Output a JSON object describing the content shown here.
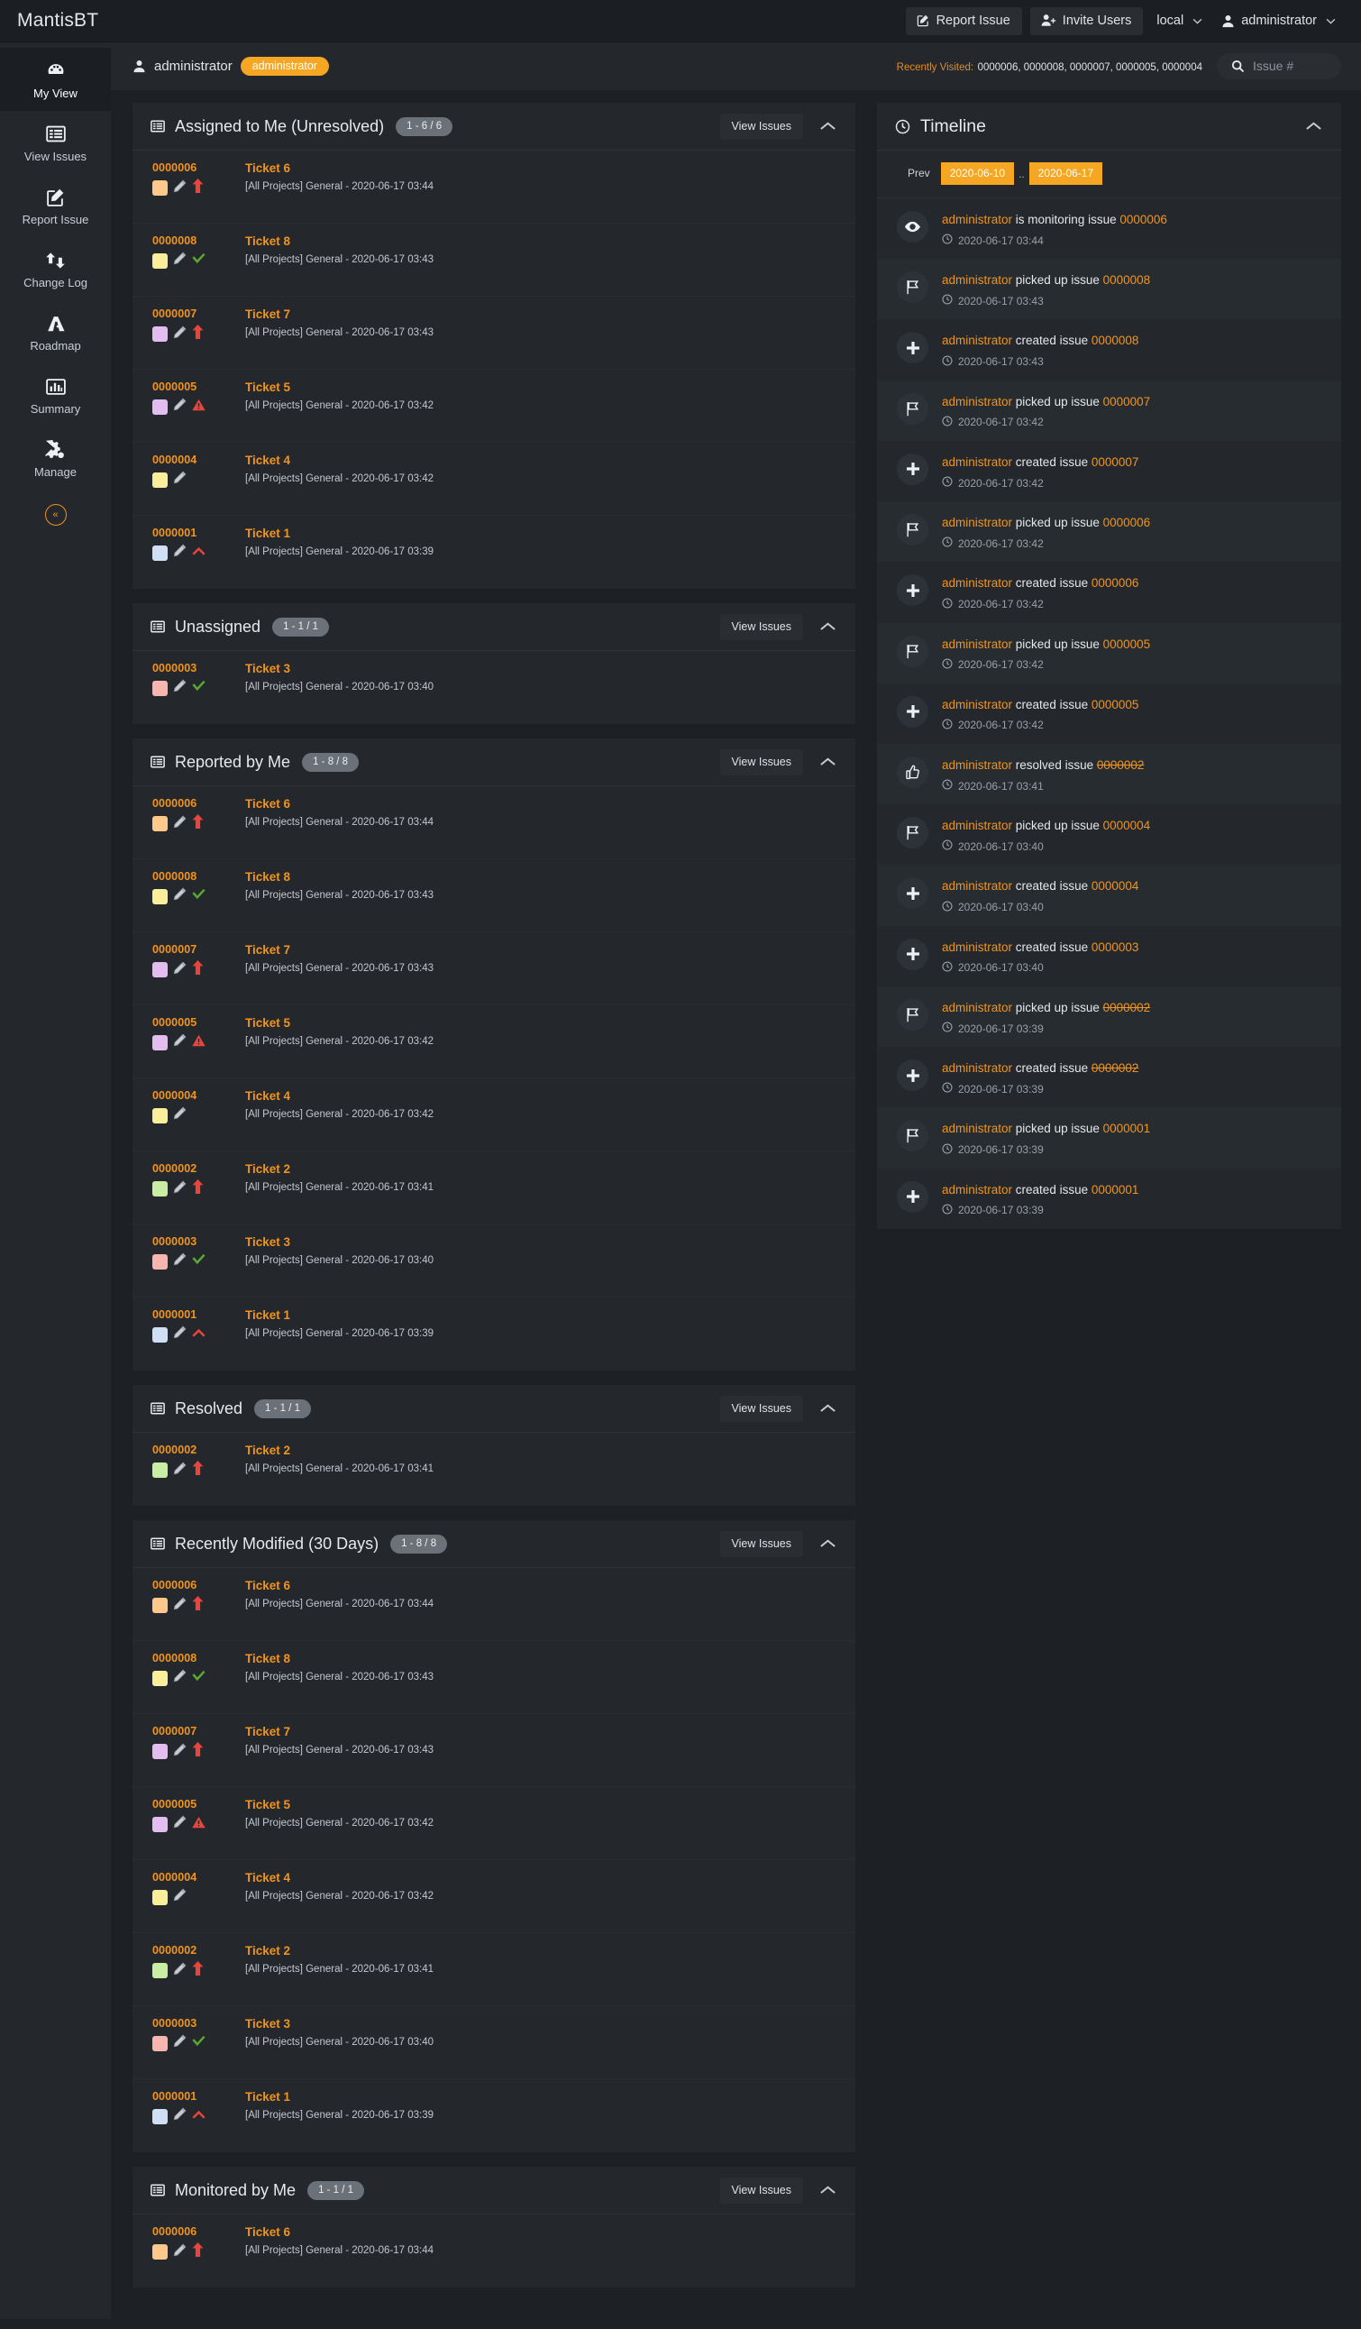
{
  "app": {
    "brand": "MantisBT"
  },
  "topbar": {
    "report_issue": "Report Issue",
    "invite_users": "Invite Users",
    "project": "local",
    "username": "administrator"
  },
  "sidebar": {
    "items": [
      {
        "label": "My View",
        "icon": "dashboard-icon",
        "active": true
      },
      {
        "label": "View Issues",
        "icon": "list-icon",
        "active": false
      },
      {
        "label": "Report Issue",
        "icon": "edit-square-icon",
        "active": false
      },
      {
        "label": "Change Log",
        "icon": "exchange-icon",
        "active": false
      },
      {
        "label": "Roadmap",
        "icon": "road-icon",
        "active": false
      },
      {
        "label": "Summary",
        "icon": "bar-chart-icon",
        "active": false
      },
      {
        "label": "Manage",
        "icon": "gears-icon",
        "active": false
      }
    ],
    "collapse_label": "«"
  },
  "userstrip": {
    "username": "administrator",
    "access_badge": "administrator",
    "recently_visited_label": "Recently Visited:",
    "recently_visited_ids": "0000006, 0000008, 0000007, 0000005, 0000004",
    "search_placeholder": "Issue #",
    "search_value": ""
  },
  "common": {
    "view_issues": "View Issues"
  },
  "panels": [
    {
      "id": "assigned-to-me",
      "title": "Assigned to Me (Unresolved)",
      "count": "1 - 6 / 6",
      "rows": [
        {
          "id": "0000006",
          "title": "Ticket 6",
          "meta": "[All Projects] General - 2020-06-17 03:44",
          "color": "#fdc88a",
          "priority": "arrow-up",
          "priority_color": "#e8453c"
        },
        {
          "id": "0000008",
          "title": "Ticket 8",
          "meta": "[All Projects] General - 2020-06-17 03:43",
          "color": "#f9ee9a",
          "priority": "check",
          "priority_color": "#5aa832"
        },
        {
          "id": "0000007",
          "title": "Ticket 7",
          "meta": "[All Projects] General - 2020-06-17 03:43",
          "color": "#e3bdf0",
          "priority": "arrow-up",
          "priority_color": "#e8453c"
        },
        {
          "id": "0000005",
          "title": "Ticket 5",
          "meta": "[All Projects] General - 2020-06-17 03:42",
          "color": "#e3bdf0",
          "priority": "warning",
          "priority_color": "#e8453c"
        },
        {
          "id": "0000004",
          "title": "Ticket 4",
          "meta": "[All Projects] General - 2020-06-17 03:42",
          "color": "#f9ee9a",
          "priority": "none",
          "priority_color": ""
        },
        {
          "id": "0000001",
          "title": "Ticket 1",
          "meta": "[All Projects] General - 2020-06-17 03:39",
          "color": "#cfe0f5",
          "priority": "chevron-up",
          "priority_color": "#e8453c"
        }
      ]
    },
    {
      "id": "unassigned",
      "title": "Unassigned",
      "count": "1 - 1 / 1",
      "rows": [
        {
          "id": "0000003",
          "title": "Ticket 3",
          "meta": "[All Projects] General - 2020-06-17 03:40",
          "color": "#f7b5b0",
          "priority": "check",
          "priority_color": "#5aa832"
        }
      ]
    },
    {
      "id": "reported-by-me",
      "title": "Reported by Me",
      "count": "1 - 8 / 8",
      "rows": [
        {
          "id": "0000006",
          "title": "Ticket 6",
          "meta": "[All Projects] General - 2020-06-17 03:44",
          "color": "#fdc88a",
          "priority": "arrow-up",
          "priority_color": "#e8453c"
        },
        {
          "id": "0000008",
          "title": "Ticket 8",
          "meta": "[All Projects] General - 2020-06-17 03:43",
          "color": "#f9ee9a",
          "priority": "check",
          "priority_color": "#5aa832"
        },
        {
          "id": "0000007",
          "title": "Ticket 7",
          "meta": "[All Projects] General - 2020-06-17 03:43",
          "color": "#e3bdf0",
          "priority": "arrow-up",
          "priority_color": "#e8453c"
        },
        {
          "id": "0000005",
          "title": "Ticket 5",
          "meta": "[All Projects] General - 2020-06-17 03:42",
          "color": "#e3bdf0",
          "priority": "warning",
          "priority_color": "#e8453c"
        },
        {
          "id": "0000004",
          "title": "Ticket 4",
          "meta": "[All Projects] General - 2020-06-17 03:42",
          "color": "#f9ee9a",
          "priority": "none",
          "priority_color": ""
        },
        {
          "id": "0000002",
          "title": "Ticket 2",
          "meta": "[All Projects] General - 2020-06-17 03:41",
          "color": "#c8eda3",
          "priority": "arrow-up",
          "priority_color": "#e8453c"
        },
        {
          "id": "0000003",
          "title": "Ticket 3",
          "meta": "[All Projects] General - 2020-06-17 03:40",
          "color": "#f7b5b0",
          "priority": "check",
          "priority_color": "#5aa832"
        },
        {
          "id": "0000001",
          "title": "Ticket 1",
          "meta": "[All Projects] General - 2020-06-17 03:39",
          "color": "#cfe0f5",
          "priority": "chevron-up",
          "priority_color": "#e8453c"
        }
      ]
    },
    {
      "id": "resolved",
      "title": "Resolved",
      "count": "1 - 1 / 1",
      "rows": [
        {
          "id": "0000002",
          "title": "Ticket 2",
          "meta": "[All Projects] General - 2020-06-17 03:41",
          "color": "#c8eda3",
          "priority": "arrow-up",
          "priority_color": "#e8453c"
        }
      ]
    },
    {
      "id": "recently-modified",
      "title": "Recently Modified (30 Days)",
      "count": "1 - 8 / 8",
      "rows": [
        {
          "id": "0000006",
          "title": "Ticket 6",
          "meta": "[All Projects] General - 2020-06-17 03:44",
          "color": "#fdc88a",
          "priority": "arrow-up",
          "priority_color": "#e8453c"
        },
        {
          "id": "0000008",
          "title": "Ticket 8",
          "meta": "[All Projects] General - 2020-06-17 03:43",
          "color": "#f9ee9a",
          "priority": "check",
          "priority_color": "#5aa832"
        },
        {
          "id": "0000007",
          "title": "Ticket 7",
          "meta": "[All Projects] General - 2020-06-17 03:43",
          "color": "#e3bdf0",
          "priority": "arrow-up",
          "priority_color": "#e8453c"
        },
        {
          "id": "0000005",
          "title": "Ticket 5",
          "meta": "[All Projects] General - 2020-06-17 03:42",
          "color": "#e3bdf0",
          "priority": "warning",
          "priority_color": "#e8453c"
        },
        {
          "id": "0000004",
          "title": "Ticket 4",
          "meta": "[All Projects] General - 2020-06-17 03:42",
          "color": "#f9ee9a",
          "priority": "none",
          "priority_color": ""
        },
        {
          "id": "0000002",
          "title": "Ticket 2",
          "meta": "[All Projects] General - 2020-06-17 03:41",
          "color": "#c8eda3",
          "priority": "arrow-up",
          "priority_color": "#e8453c"
        },
        {
          "id": "0000003",
          "title": "Ticket 3",
          "meta": "[All Projects] General - 2020-06-17 03:40",
          "color": "#f7b5b0",
          "priority": "check",
          "priority_color": "#5aa832"
        },
        {
          "id": "0000001",
          "title": "Ticket 1",
          "meta": "[All Projects] General - 2020-06-17 03:39",
          "color": "#cfe0f5",
          "priority": "chevron-up",
          "priority_color": "#e8453c"
        }
      ]
    },
    {
      "id": "monitored-by-me",
      "title": "Monitored by Me",
      "count": "1 - 1 / 1",
      "rows": [
        {
          "id": "0000006",
          "title": "Ticket 6",
          "meta": "[All Projects] General - 2020-06-17 03:44",
          "color": "#fdc88a",
          "priority": "arrow-up",
          "priority_color": "#e8453c"
        }
      ]
    }
  ],
  "timeline": {
    "title": "Timeline",
    "prev_label": "Prev",
    "date_from": "2020-06-10",
    "date_sep": "..",
    "date_to": "2020-06-17",
    "items": [
      {
        "icon": "eye-icon",
        "user": "administrator",
        "action": "is monitoring issue",
        "issue": "0000006",
        "struck": false,
        "time": "2020-06-17 03:44"
      },
      {
        "icon": "flag-icon",
        "user": "administrator",
        "action": "picked up issue",
        "issue": "0000008",
        "struck": false,
        "time": "2020-06-17 03:43"
      },
      {
        "icon": "plus-icon",
        "user": "administrator",
        "action": "created issue",
        "issue": "0000008",
        "struck": false,
        "time": "2020-06-17 03:43"
      },
      {
        "icon": "flag-icon",
        "user": "administrator",
        "action": "picked up issue",
        "issue": "0000007",
        "struck": false,
        "time": "2020-06-17 03:42"
      },
      {
        "icon": "plus-icon",
        "user": "administrator",
        "action": "created issue",
        "issue": "0000007",
        "struck": false,
        "time": "2020-06-17 03:42"
      },
      {
        "icon": "flag-icon",
        "user": "administrator",
        "action": "picked up issue",
        "issue": "0000006",
        "struck": false,
        "time": "2020-06-17 03:42"
      },
      {
        "icon": "plus-icon",
        "user": "administrator",
        "action": "created issue",
        "issue": "0000006",
        "struck": false,
        "time": "2020-06-17 03:42"
      },
      {
        "icon": "flag-icon",
        "user": "administrator",
        "action": "picked up issue",
        "issue": "0000005",
        "struck": false,
        "time": "2020-06-17 03:42"
      },
      {
        "icon": "plus-icon",
        "user": "administrator",
        "action": "created issue",
        "issue": "0000005",
        "struck": false,
        "time": "2020-06-17 03:42"
      },
      {
        "icon": "thumbs-up-icon",
        "user": "administrator",
        "action": "resolved issue",
        "issue": "0000002",
        "struck": true,
        "time": "2020-06-17 03:41"
      },
      {
        "icon": "flag-icon",
        "user": "administrator",
        "action": "picked up issue",
        "issue": "0000004",
        "struck": false,
        "time": "2020-06-17 03:40"
      },
      {
        "icon": "plus-icon",
        "user": "administrator",
        "action": "created issue",
        "issue": "0000004",
        "struck": false,
        "time": "2020-06-17 03:40"
      },
      {
        "icon": "plus-icon",
        "user": "administrator",
        "action": "created issue",
        "issue": "0000003",
        "struck": false,
        "time": "2020-06-17 03:40"
      },
      {
        "icon": "flag-icon",
        "user": "administrator",
        "action": "picked up issue",
        "issue": "0000002",
        "struck": true,
        "time": "2020-06-17 03:39"
      },
      {
        "icon": "plus-icon",
        "user": "administrator",
        "action": "created issue",
        "issue": "0000002",
        "struck": true,
        "time": "2020-06-17 03:39"
      },
      {
        "icon": "flag-icon",
        "user": "administrator",
        "action": "picked up issue",
        "issue": "0000001",
        "struck": false,
        "time": "2020-06-17 03:39"
      },
      {
        "icon": "plus-icon",
        "user": "administrator",
        "action": "created issue",
        "issue": "0000001",
        "struck": false,
        "time": "2020-06-17 03:39"
      }
    ]
  }
}
